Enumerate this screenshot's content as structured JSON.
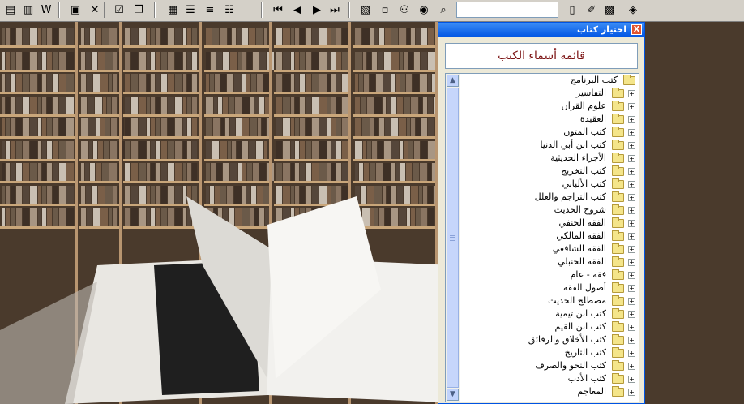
{
  "toolbar": {
    "buttons": [
      {
        "name": "word-export-icon",
        "glyph": "▤"
      },
      {
        "name": "book-icon",
        "glyph": "▥"
      },
      {
        "name": "word-doc-icon",
        "glyph": "W"
      },
      {
        "name": "save-icon",
        "glyph": "▣"
      },
      {
        "name": "close-icon",
        "glyph": "✕"
      },
      {
        "name": "clipboard-check-icon",
        "glyph": "☑"
      },
      {
        "name": "copy-icon",
        "glyph": "❐"
      },
      {
        "name": "properties-icon",
        "glyph": "▦"
      },
      {
        "name": "list-icon",
        "glyph": "☰"
      },
      {
        "name": "justify-icon",
        "glyph": "≡"
      },
      {
        "name": "open-book-icon",
        "glyph": "☷"
      },
      {
        "name": "first-page-icon",
        "glyph": "⏮"
      },
      {
        "name": "previous-icon",
        "glyph": "◀"
      },
      {
        "name": "next-icon",
        "glyph": "▶"
      },
      {
        "name": "last-page-icon",
        "glyph": "⏭"
      },
      {
        "name": "windows-icon",
        "glyph": "▧"
      },
      {
        "name": "open-folder-icon",
        "glyph": "▫"
      },
      {
        "name": "binoculars-icon",
        "glyph": "⚇"
      },
      {
        "name": "search-book-icon",
        "glyph": "◉"
      },
      {
        "name": "find-page-icon",
        "glyph": "⌕"
      }
    ],
    "right_buttons": [
      {
        "name": "new-page-icon",
        "glyph": "▯"
      },
      {
        "name": "attachment-icon",
        "glyph": "✐"
      },
      {
        "name": "tree-view-icon",
        "glyph": "▩"
      },
      {
        "name": "library-icon",
        "glyph": "◈"
      }
    ],
    "search_value": ""
  },
  "dialog": {
    "title": "اختيار كتاب",
    "close_label": "X",
    "header": "قائمة أسماء الكتب",
    "root_label": "كتب البرنامج",
    "items": [
      "التفاسير",
      "علوم القرآن",
      "العقيدة",
      "كتب المتون",
      "كتب ابن أبي الدنيا",
      "الأجزاء الحديثية",
      "كتب التخريج",
      "كتب الألباني",
      "كتب التراجم والعلل",
      "شروح الحديث",
      "الفقه الحنفي",
      "الفقه المالكي",
      "الفقه الشافعي",
      "الفقه الحنبلي",
      "فقه - عام",
      "أصول الفقه",
      "مصطلح الحديث",
      "كتب ابن تيمية",
      "كتب ابن القيم",
      "كتب الأخلاق والرقائق",
      "كتب التاريخ",
      "كتب النحو والصرف",
      "كتب الأدب",
      "المعاجم"
    ]
  },
  "colors": {
    "title_bar": "#0054e3",
    "header_text": "#7a1010",
    "folder_fill": "#f4e58a"
  }
}
